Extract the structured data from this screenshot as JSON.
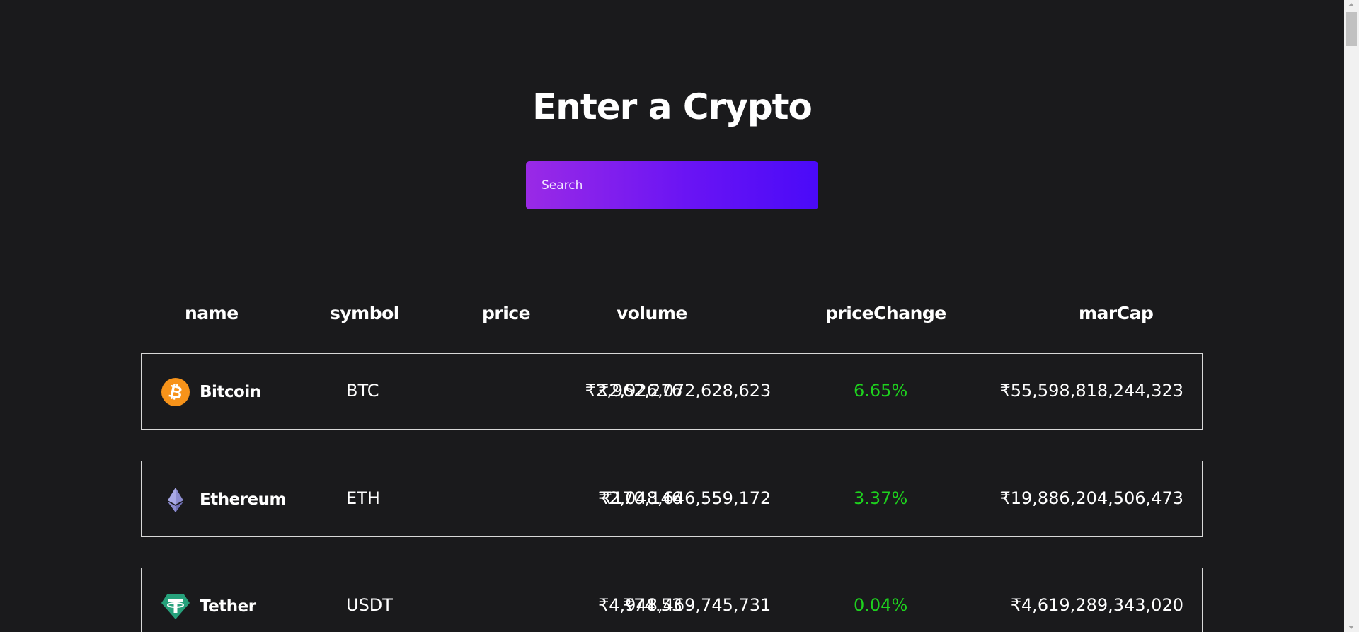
{
  "page": {
    "title": "Enter a Crypto"
  },
  "search": {
    "placeholder": "Search",
    "value": ""
  },
  "table": {
    "headers": {
      "name": "name",
      "symbol": "symbol",
      "price": "price",
      "volume": "volume",
      "priceChange": "priceChange",
      "marCap": "marCap"
    },
    "rows": [
      {
        "name": "Bitcoin",
        "symbol": "BTC",
        "price": "₹2,962,276",
        "volume": "₹2,926,072,628,623",
        "priceChange": "6.65%",
        "marCap": "₹55,598,818,244,323",
        "icon": "bitcoin-icon"
      },
      {
        "name": "Ethereum",
        "symbol": "ETH",
        "price": "₹170,146",
        "volume": "₹2,048,646,559,172",
        "priceChange": "3.37%",
        "marCap": "₹19,886,204,506,473",
        "icon": "ethereum-icon"
      },
      {
        "name": "Tether",
        "symbol": "USDT",
        "price": "₹74.53",
        "volume": "₹4,948,469,745,731",
        "priceChange": "0.04%",
        "marCap": "₹4,619,289,343,020",
        "icon": "tether-icon"
      }
    ]
  },
  "colors": {
    "background": "#1a1a1c",
    "search_gradient_start": "#9a2ae6",
    "search_gradient_end": "#4a0af8",
    "positive_change": "#1ed21e",
    "bitcoin": "#f7931a",
    "tether": "#26a17b",
    "ethereum": "#8c8ccf"
  }
}
